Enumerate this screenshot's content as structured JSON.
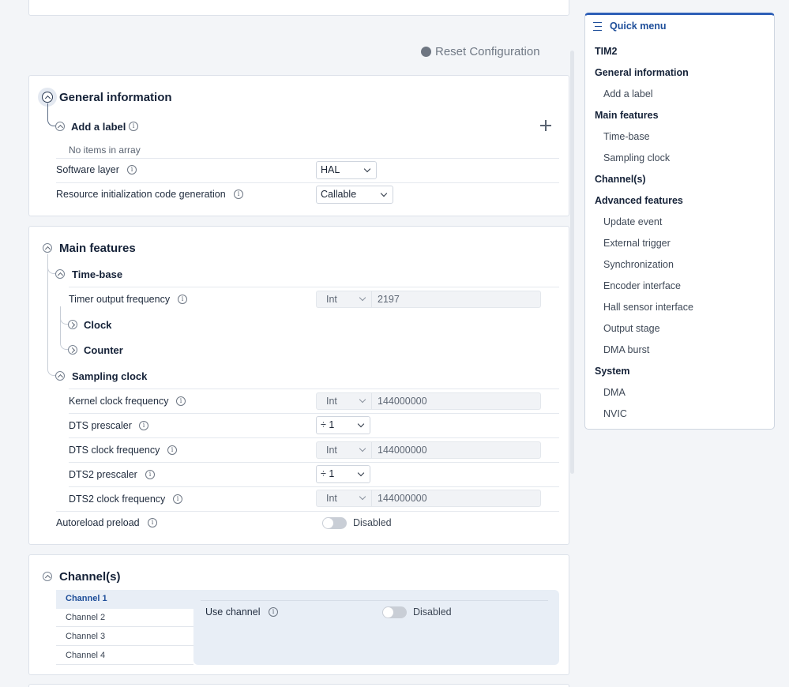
{
  "toolbar": {
    "reset_label": "Reset Configuration"
  },
  "general": {
    "title": "General information",
    "add_label": "Add a label",
    "empty_text": "No items in array",
    "software_layer_label": "Software layer",
    "software_layer_value": "HAL",
    "resource_init_label": "Resource initialization code generation",
    "resource_init_value": "Callable"
  },
  "main": {
    "title": "Main features",
    "timebase": "Time-base",
    "timer_output_label": "Timer output frequency",
    "timer_output_unit": "Int",
    "timer_output_value": "2197",
    "clock": "Clock",
    "counter": "Counter",
    "sampling": "Sampling clock",
    "kernel_label": "Kernel clock frequency",
    "kernel_unit": "Int",
    "kernel_value": "144000000",
    "dts_prescaler_label": "DTS prescaler",
    "dts_prescaler_value": "÷ 1",
    "dts_clock_label": "DTS clock frequency",
    "dts_clock_unit": "Int",
    "dts_clock_value": "144000000",
    "dts2_prescaler_label": "DTS2 prescaler",
    "dts2_prescaler_value": "÷ 1",
    "dts2_clock_label": "DTS2 clock frequency",
    "dts2_clock_unit": "Int",
    "dts2_clock_value": "144000000",
    "autoreload_label": "Autoreload preload",
    "autoreload_state": "Disabled"
  },
  "channels": {
    "title": "Channel(s)",
    "tabs": [
      "Channel 1",
      "Channel 2",
      "Channel 3",
      "Channel 4"
    ],
    "use_channel_label": "Use channel",
    "use_channel_state": "Disabled"
  },
  "quick_menu": {
    "title": "Quick menu",
    "items": [
      {
        "label": "TIM2",
        "level": "h"
      },
      {
        "label": "General information",
        "level": "h"
      },
      {
        "label": "Add a label",
        "level": "s"
      },
      {
        "label": "Main features",
        "level": "h"
      },
      {
        "label": "Time-base",
        "level": "s"
      },
      {
        "label": "Sampling clock",
        "level": "s"
      },
      {
        "label": "Channel(s)",
        "level": "h"
      },
      {
        "label": "Advanced features",
        "level": "h"
      },
      {
        "label": "Update event",
        "level": "s"
      },
      {
        "label": "External trigger",
        "level": "s"
      },
      {
        "label": "Synchronization",
        "level": "s"
      },
      {
        "label": "Encoder interface",
        "level": "s"
      },
      {
        "label": "Hall sensor interface",
        "level": "s"
      },
      {
        "label": "Output stage",
        "level": "s"
      },
      {
        "label": "DMA burst",
        "level": "s"
      },
      {
        "label": "System",
        "level": "h"
      },
      {
        "label": "DMA",
        "level": "s"
      },
      {
        "label": "NVIC",
        "level": "s"
      }
    ]
  }
}
